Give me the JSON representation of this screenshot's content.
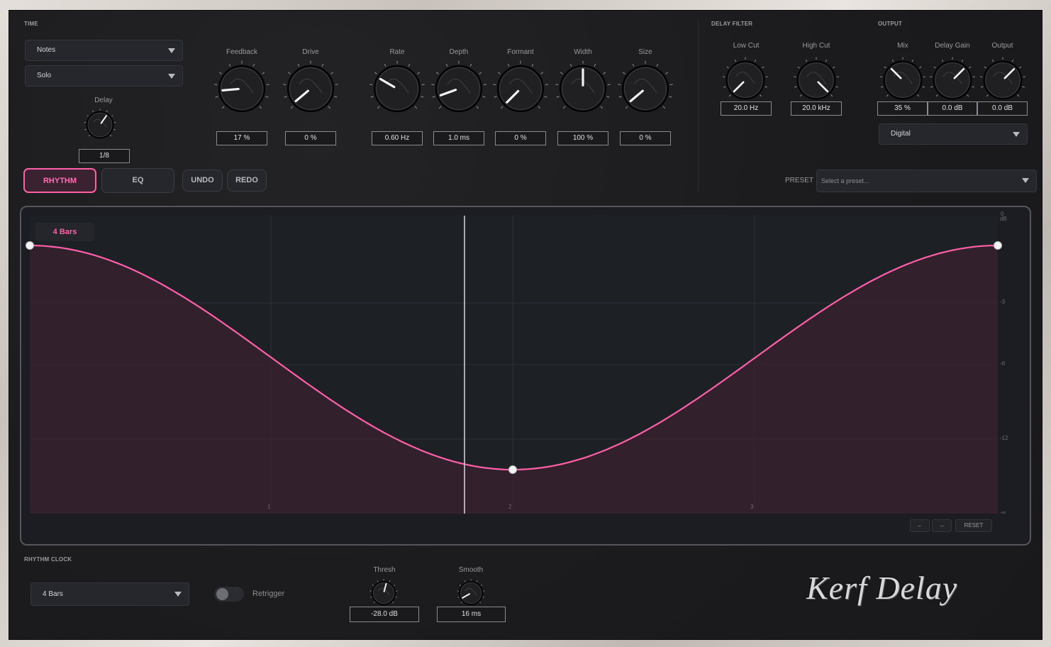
{
  "sections": {
    "time": "TIME",
    "delay_filter": "DELAY FILTER",
    "output": "OUTPUT",
    "rhythm_clock": "RHYTHM CLOCK",
    "preset": "PRESET"
  },
  "time": {
    "mode_value": "Notes",
    "sync_value": "Solo",
    "delay_label": "Delay",
    "delay_value": "1/8"
  },
  "knobs": [
    {
      "label": "Feedback",
      "value": "17 %"
    },
    {
      "label": "Drive",
      "value": "0 %"
    },
    {
      "label": "Rate",
      "value": "0.60 Hz"
    },
    {
      "label": "Depth",
      "value": "1.0 ms"
    },
    {
      "label": "Formant",
      "value": "0 %"
    },
    {
      "label": "Width",
      "value": "100 %"
    },
    {
      "label": "Size",
      "value": "0 %"
    }
  ],
  "delay_filter": {
    "low_cut_label": "Low Cut",
    "low_cut_value": "20.0 Hz",
    "high_cut_label": "High Cut",
    "high_cut_value": "20.0 kHz"
  },
  "output": {
    "mix_label": "Mix",
    "mix_value": "35 %",
    "delay_gain_label": "Delay Gain",
    "delay_gain_value": "0.0 dB",
    "output_label": "Output",
    "output_value": "0.0 dB",
    "mode_value": "Digital"
  },
  "tabs": {
    "rhythm": "RHYTHM",
    "eq": "EQ",
    "undo": "UNDO",
    "redo": "REDO"
  },
  "preset": {
    "placeholder": "Select a preset..."
  },
  "graph": {
    "length_badge": "4 Bars",
    "db_top": "0",
    "db_unit": "dB",
    "db_ticks": [
      "-3",
      "-6",
      "-12",
      "-∞"
    ],
    "bar_ticks": [
      "1",
      "2",
      "3"
    ],
    "reset": "RESET",
    "accent": "#ff5fa8"
  },
  "rhythm_clock": {
    "length_value": "4 Bars",
    "retrigger_label": "Retrigger",
    "thresh_label": "Thresh",
    "thresh_value": "-28.0 dB",
    "smooth_label": "Smooth",
    "smooth_value": "16 ms"
  },
  "brand": "Kerf Delay"
}
